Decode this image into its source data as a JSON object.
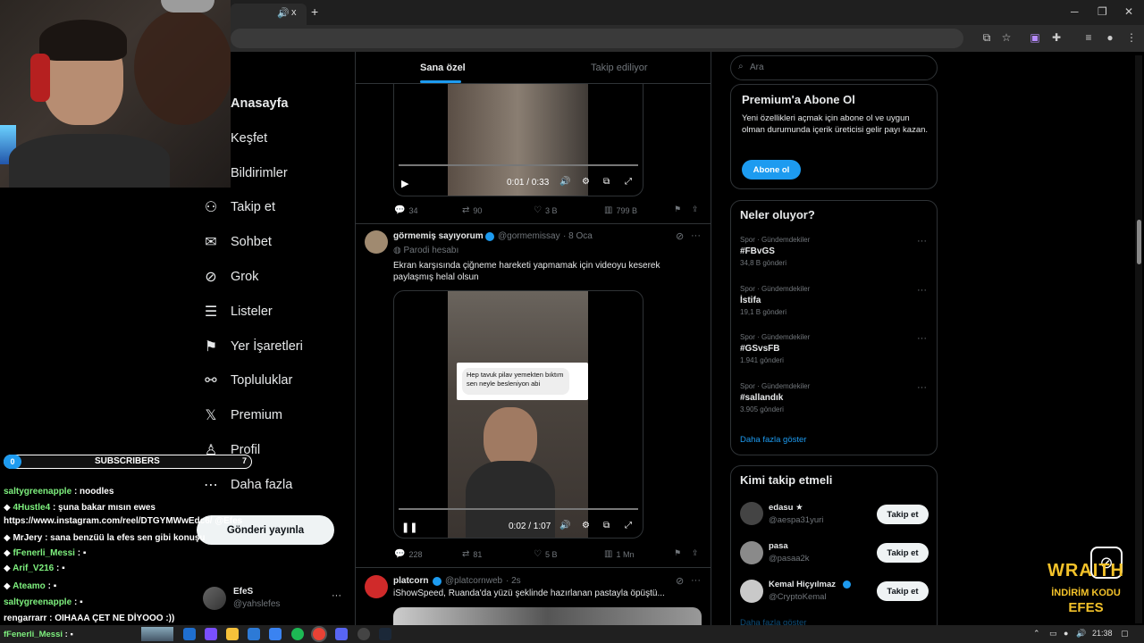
{
  "browser": {
    "tab_close": "x",
    "new_tab": "+",
    "window_controls": [
      "─",
      "❐",
      "✕"
    ]
  },
  "nav": {
    "items": [
      {
        "label": "Anasayfa",
        "icon": "home-icon"
      },
      {
        "label": "Keşfet",
        "icon": "search-icon"
      },
      {
        "label": "Bildirimler",
        "icon": "bell-icon"
      },
      {
        "label": "Takip et",
        "icon": "person-add-icon"
      },
      {
        "label": "Sohbet",
        "icon": "mail-icon"
      },
      {
        "label": "Grok",
        "icon": "grok-icon"
      },
      {
        "label": "Listeler",
        "icon": "list-icon"
      },
      {
        "label": "Yer İşaretleri",
        "icon": "bookmark-icon"
      },
      {
        "label": "Topluluklar",
        "icon": "communities-icon"
      },
      {
        "label": "Premium",
        "icon": "x-logo-icon"
      },
      {
        "label": "Profil",
        "icon": "profile-icon"
      },
      {
        "label": "Daha fazla",
        "icon": "more-icon"
      }
    ],
    "post_button": "Gönderi yayınla",
    "account": {
      "name": "EfeS",
      "handle": "@yahslefes"
    }
  },
  "feed": {
    "tabs": [
      "Sana özel",
      "Takip ediliyor"
    ],
    "post1": {
      "time": "0:01 / 0:33",
      "replies": "34",
      "reposts": "90",
      "likes": "3 B",
      "views": "799 B"
    },
    "post2": {
      "name": "görmemiş sayıyorum",
      "handle": "@gormemissay",
      "date": "· 8 Oca",
      "parody": "Parodi hesabı",
      "text": "Ekran karşısında çiğneme hareketi yapmamak için videoyu keserek paylaşmış helal olsun",
      "overlay_text": "Hep tavuk pilav yemekten bıktım sen neyle besleniyon abi",
      "time": "0:02 / 1:07",
      "replies": "228",
      "reposts": "81",
      "likes": "5 B",
      "views": "1 Mn"
    },
    "post3": {
      "name": "platcorn",
      "handle": "@platcornweb",
      "date": "· 2s",
      "text": "iShowSpeed, Ruanda'da yüzü şeklinde hazırlanan pastayla öpüştü..."
    }
  },
  "sidebar": {
    "search_placeholder": "Ara",
    "premium": {
      "title": "Premium'a Abone Ol",
      "body": "Yeni özellikleri açmak için abone ol ve uygun olman durumunda içerik üreticisi gelir payı kazan.",
      "button": "Abone ol"
    },
    "trends_title": "Neler oluyor?",
    "trends": [
      {
        "category": "Spor · Gündemdekiler",
        "name": "#FBvGS",
        "count": "34,8 B gönderi"
      },
      {
        "category": "Spor · Gündemdekiler",
        "name": "İstifa",
        "count": "19,1 B gönderi"
      },
      {
        "category": "Spor · Gündemdekiler",
        "name": "#GSvsFB",
        "count": "1.941 gönderi"
      },
      {
        "category": "Spor · Gündemdekiler",
        "name": "#sallandık",
        "count": "3.905 gönderi"
      }
    ],
    "show_more": "Daha fazla göster",
    "who_to_follow_title": "Kimi takip etmeli",
    "who_to_follow": [
      {
        "name": "edasu ★",
        "handle": "@aespa31yuri",
        "button": "Takip et"
      },
      {
        "name": "pasa",
        "handle": "@pasaa2k",
        "button": "Takip et"
      },
      {
        "name": "Kemal Hiçyılmaz",
        "handle": "@CryptoKemal",
        "button": "Takip et"
      }
    ],
    "show_more2": "Daha fazla göster"
  },
  "stream": {
    "subs_left": "0",
    "subs_label": "SUBSCRIBERS",
    "subs_right": "7",
    "chat": [
      {
        "user": "saltygreenapple",
        "msg": ": noodles"
      },
      {
        "user": "4Hustle4",
        "msg": ": şuna bakar mısın ewes"
      },
      {
        "user": "",
        "msg": "https://www.instagram.com/reel/DTGYMWwEdc6/ @Efes"
      },
      {
        "user": "MrJery",
        "msg": ": sana benzüü la efes sen gibi konuşu"
      },
      {
        "user": "fFenerli_Messi",
        "msg": ":"
      },
      {
        "user": "Arif_V216",
        "msg": ":"
      },
      {
        "user": "Ateamo",
        "msg": ":"
      },
      {
        "user": "saltygreenapple",
        "msg": ":"
      },
      {
        "user": "rengarrarr",
        "msg": ": OIHAAA ÇET NE DİYOOO :))"
      },
      {
        "user": "fFenerli_Messi",
        "msg": ":"
      }
    ],
    "sponsor_line1": "WRAITH",
    "sponsor_line2": "İNDİRİM KODU",
    "sponsor_line3": "EFES"
  },
  "taskbar": {
    "time": "21:38"
  }
}
